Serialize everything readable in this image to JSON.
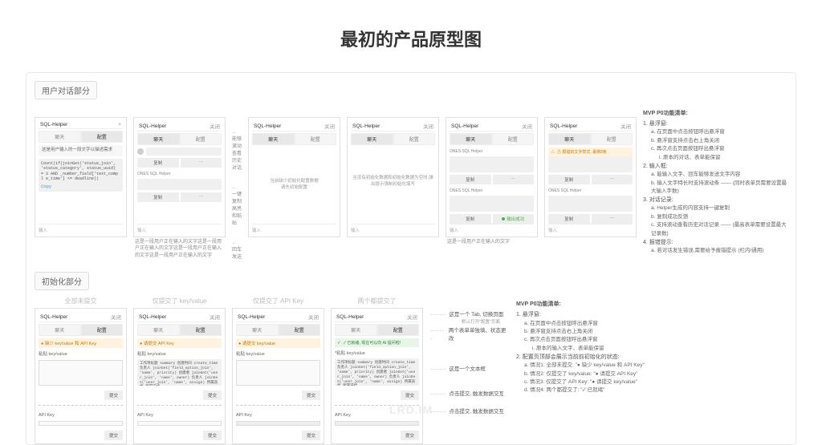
{
  "page_title": "最初的产品原型图",
  "section1_label": "用户对话部分",
  "section2_label": "初始化部分",
  "mock_header_title": "SQL-Helper",
  "mock_header_close": "关闭",
  "mock_header_x": "×",
  "tab_chat": "聊天",
  "tab_config": "配置",
  "m1_msg": "这是用户输入的一段文字以描述需求",
  "m1_code": "Count(if(joinGet('status_join', 'status_category', status_uuid) = 3 AND _number_field['text_compl e_time'] <= deadline))",
  "m1_copy": "Copy",
  "input_placeholder": "输入",
  "m2_copy_btn": "复制",
  "m2_ones": "ONES SQL Helper",
  "m2_desc": "这是一段用户正在输入的文字这是一段用户正在输入的文字这是一段用户正在输入的文字这是一段用户正在输入的文字",
  "arrow1": "能够滚动查看历史对话",
  "arrow2": "一键复制高亮和粘贴",
  "arrow3": "回车发送",
  "m3_center": "当前缺少初始化配置数据\n请先初始配置",
  "m4_center": "当没有初始化数据和初始化数据为空时,弹出提示强制初始化填写",
  "m5_desc": "这是一段用户正在输入的文字",
  "m5_green": "输出成功",
  "m6_warn": "⚠ 报错的文字样式, 最常8条",
  "annotations_title": "MVP P0功能清单:",
  "ann": {
    "i1": "1. 悬浮窗:",
    "i1a": "a. 在页面中点击按钮呼出悬浮窗",
    "i1b": "b. 悬浮窗支持点击右上角关闭",
    "i1c": "c. 再次点击页面按钮呼出悬浮窗",
    "i1d": "i. 原本的对话、表单能保留",
    "i2": "2. 输入框:",
    "i2a": "a. 能输入文字、回车能够发送文字内容",
    "i2b": "b. 输入文字特长时支持滚动条 —— (同时表单页需要设置最大输入字数)",
    "i3": "3. 对话记录:",
    "i3a": "a. Helper生成的内容支持一键复制",
    "i3b": "b. 复制成功反馈",
    "i3c": "c. 支持滚动查看历史对话记录 —— (最高表单需要设置最大记录数)",
    "i4": "4. 报错提示:",
    "i4a": "a. 若对话发生错误,需要给予报错提示 (栏内/通用)"
  },
  "init_labels": {
    "c1": "全部未提交",
    "c2": "仅提交了 key/value",
    "c3": "仅提交了 API Key",
    "c4": "两个都提交了"
  },
  "init_status": {
    "s1": "● 缺少 key/value 和 API Key",
    "s2": "● 请提交 API Key",
    "s3": "● 请提交 key/value",
    "s4": "✓ 已就绪, 现在可以向 AI 提问啦!"
  },
  "field_paste": "粘贴 key/value",
  "field_paste_star": "*粘贴 key/value",
  "field_apikey": "API Key",
  "btn_submit": "提交",
  "code_sample": "工作项标题\nsummary\n创建时间\ncreate_time\n负责人\njoinGet('field_option_join', 'name', priority)\n创建者\njoinGet('user_join', 'name', owner)\n负责人\njoinGet('user_join', 'name', assign)\n所属迭代\n所属迭代",
  "init_notes": {
    "n1": "这是一个 Tab, 切换页面",
    "n1sub": "默认打开\"配置\"页面",
    "n2": "两个表单单独填、状态更改",
    "n3": "这是一个文本框",
    "n4": "点击提交, 触发数据交互",
    "n5": "点击提交, 触发数据交互"
  },
  "init_ann_title": "MVP P0功能清单:",
  "init_ann": {
    "i1": "1. 悬浮窗:",
    "i1a": "a. 在页面中点击按钮呼出悬浮窗",
    "i1b": "b. 悬浮窗支持点击右上角关闭",
    "i1c": "c. 再次点击页面按钮呼出悬浮窗",
    "i1d": "i. 原本的输入文字、表单能保留",
    "i2": "2. 配置页顶部会展示当前前初始化的状态:",
    "i2a": "a. 情况1: 全部未提交: \"● 缺少 key/value 和 API Key\"",
    "i2b": "b. 情况2: 仅提交了 key/value: \"● 请提交 API Key\"",
    "i2c": "c. 情况3: 仅提交了 API Key: \"● 请提交 key/value\"",
    "i2d": "d. 情况4: 两个都提交了: \"✓ 已就绪\""
  },
  "watermark": "LRD.IM"
}
